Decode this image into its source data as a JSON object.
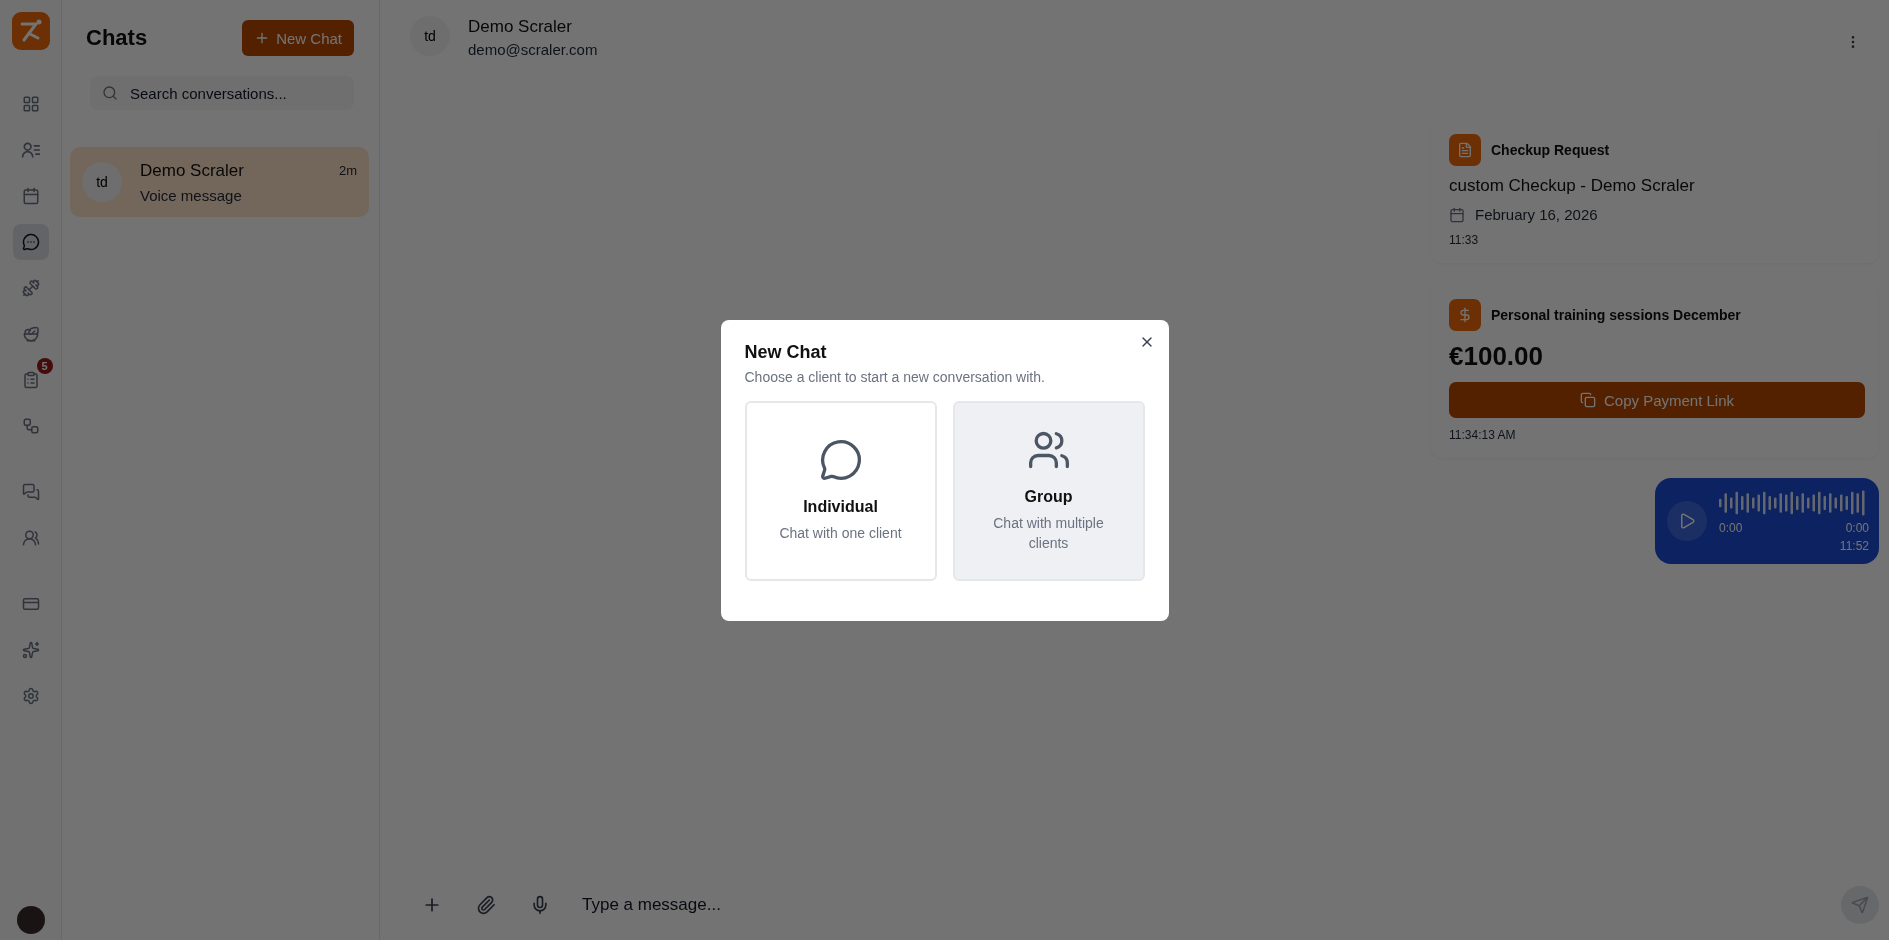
{
  "nav_groups": [
    [
      {
        "kind": "grid",
        "selected": false
      },
      {
        "kind": "contacts",
        "selected": false
      },
      {
        "kind": "calendar",
        "selected": false
      },
      {
        "kind": "chat",
        "selected": true
      },
      {
        "kind": "dumbbell",
        "selected": false
      },
      {
        "kind": "salad",
        "selected": false
      },
      {
        "kind": "clipboard",
        "selected": false,
        "badge": "5"
      },
      {
        "kind": "workflow",
        "selected": false
      }
    ],
    [
      {
        "kind": "messages",
        "selected": false
      },
      {
        "kind": "team",
        "selected": false
      }
    ],
    [
      {
        "kind": "card",
        "selected": false
      },
      {
        "kind": "sparkles",
        "selected": false
      },
      {
        "kind": "settings",
        "selected": false
      }
    ]
  ],
  "chat_list": {
    "title": "Chats",
    "new_button": "New Chat",
    "search": {
      "placeholder": "Search conversations..."
    },
    "items": [
      {
        "initials": "td",
        "name": "Demo Scraler",
        "preview": "Voice message",
        "time": "2m",
        "selected": true
      }
    ]
  },
  "conversation": {
    "initials": "td",
    "name": "Demo Scraler",
    "email": "demo@scraler.com",
    "messages": [
      {
        "kind": "checkup",
        "label": "Checkup Request",
        "title": "custom Checkup - Demo Scraler",
        "date": "February 16, 2026",
        "time": "11:33"
      },
      {
        "kind": "payment",
        "label": "Personal training sessions December",
        "amount": "€100.00",
        "button": "Copy Payment Link",
        "time": "11:34:13 AM"
      },
      {
        "kind": "voice",
        "start": "0:00",
        "end": "0:00",
        "time": "11:52"
      }
    ],
    "composer": {
      "placeholder": "Type a message..."
    }
  },
  "modal": {
    "title": "New Chat",
    "subtitle": "Choose a client to start a new conversation with.",
    "options": [
      {
        "kind": "individual",
        "title": "Individual",
        "description": "Chat with one client",
        "selected": false
      },
      {
        "kind": "group",
        "title": "Group",
        "description": "Chat with multiple clients",
        "selected": true
      }
    ]
  }
}
